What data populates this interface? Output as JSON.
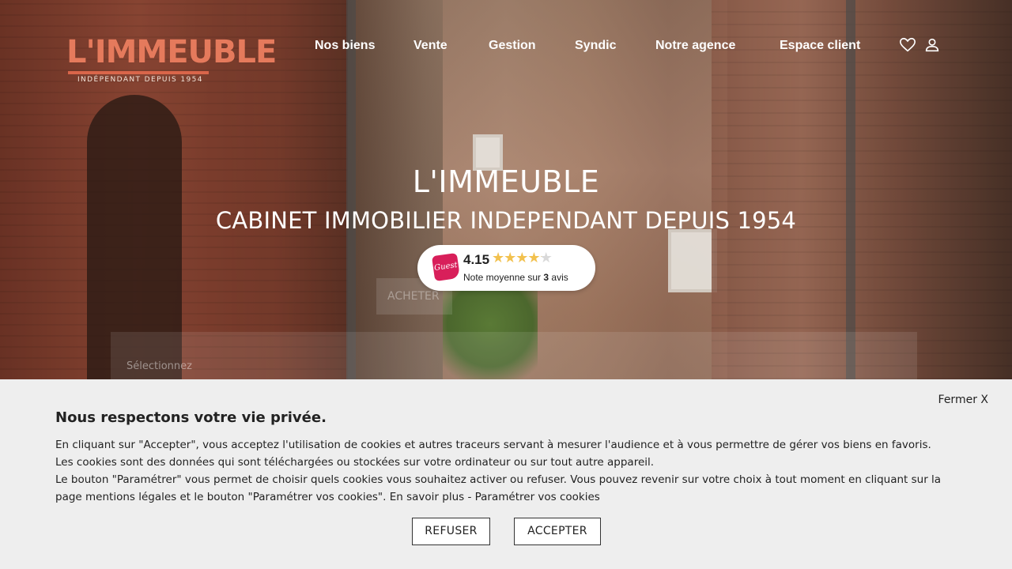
{
  "brand": {
    "logo_text": "L'IMMEUBLE",
    "logo_tagline": "INDÉPENDANT DEPUIS 1954",
    "accent_color": "#e57a5c"
  },
  "nav": {
    "items": [
      "Nos biens",
      "Vente",
      "Gestion",
      "Syndic",
      "Notre agence",
      "Espace client"
    ],
    "icons": [
      "heart-icon",
      "user-icon"
    ]
  },
  "hero": {
    "title": "L'IMMEUBLE",
    "subtitle": "CABINET IMMOBILIER INDEPENDANT DEPUIS 1954",
    "behind_tab_label": "ACHETER",
    "behind_select_label": "Sélectionnez"
  },
  "rating": {
    "logo_text": "Guest",
    "score": "4.15",
    "stars_value": 4.15,
    "stars_max": 5,
    "note_prefix": "Note moyenne sur ",
    "count": "3",
    "note_suffix": " avis"
  },
  "cookie": {
    "close_label": "Fermer X",
    "title": "Nous respectons votre vie privée.",
    "line1": "En cliquant sur \"Accepter\", vous acceptez l'utilisation de cookies et autres traceurs servant à mesurer l'audience et à vous permettre de gérer vos biens en favoris.",
    "line2": "Les cookies sont des données qui sont téléchargées ou stockées sur votre ordinateur ou sur tout autre appareil.",
    "line3": "Le bouton \"Paramétrer\" vous permet de choisir quels cookies vous souhaitez activer ou refuser. Vous pouvez revenir sur votre choix à tout moment en cliquant sur la page mentions légales et le bouton \"Paramétrer vos cookies\".",
    "link_more": "En savoir plus",
    "link_sep": " - ",
    "link_settings": "Paramétrer vos cookies",
    "refuse_label": "REFUSER",
    "accept_label": "ACCEPTER"
  }
}
